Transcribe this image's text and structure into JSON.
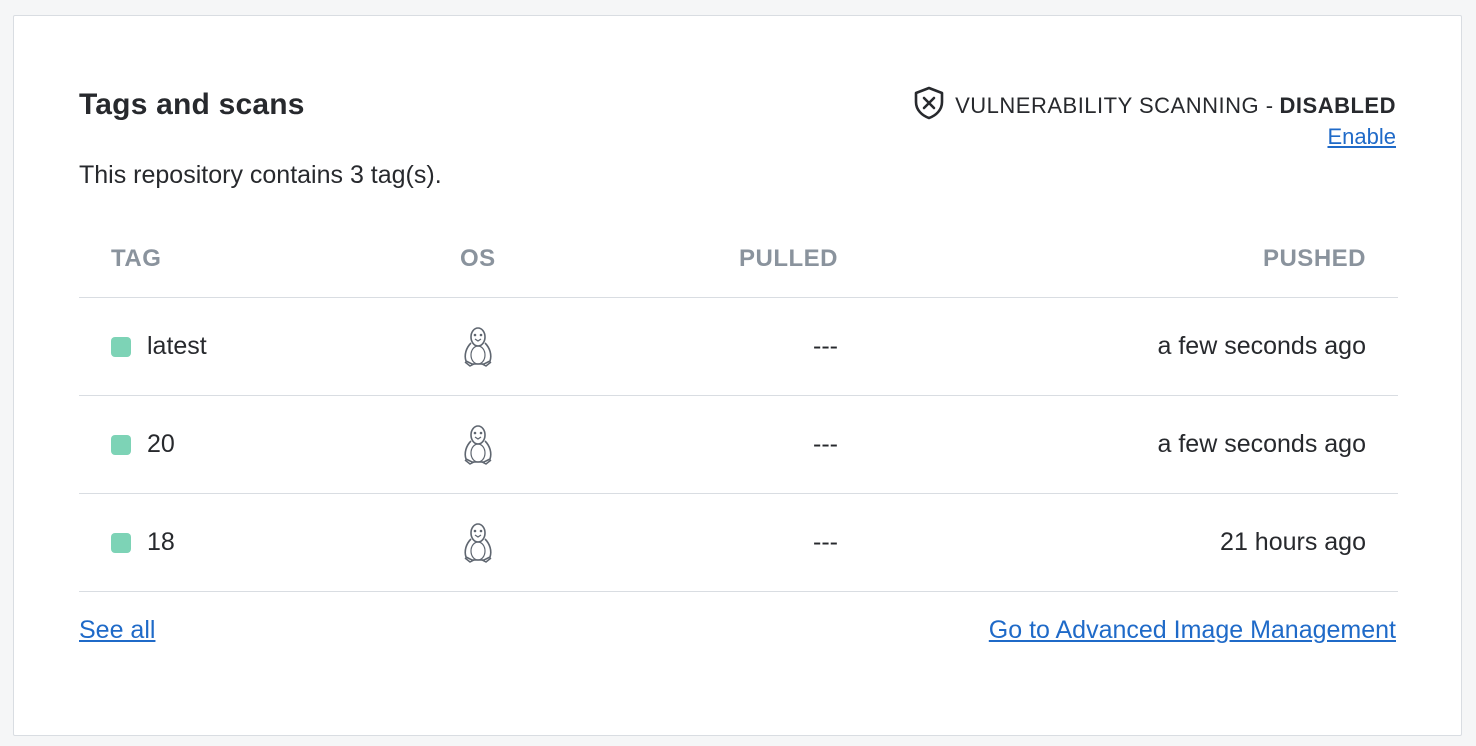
{
  "card": {
    "title": "Tags and scans",
    "subtitle": "This repository contains 3 tag(s).",
    "scan": {
      "label": "VULNERABILITY SCANNING -",
      "status": "DISABLED",
      "icon": "shield-x-icon",
      "enable_link": "Enable"
    }
  },
  "table": {
    "headers": {
      "tag": "TAG",
      "os": "OS",
      "pulled": "PULLED",
      "pushed": "PUSHED"
    },
    "rows": [
      {
        "tag": "latest",
        "os_icon": "linux-icon",
        "pulled": "---",
        "pushed": "a few seconds ago"
      },
      {
        "tag": "20",
        "os_icon": "linux-icon",
        "pulled": "---",
        "pushed": "a few seconds ago"
      },
      {
        "tag": "18",
        "os_icon": "linux-icon",
        "pulled": "---",
        "pushed": "21 hours ago"
      }
    ]
  },
  "footer": {
    "see_all": "See all",
    "advanced": "Go to Advanced Image Management"
  },
  "colors": {
    "status_dot": "#7dd3b6",
    "link": "#1f6ac8",
    "header_text": "#8a939d",
    "text": "#27292d"
  }
}
